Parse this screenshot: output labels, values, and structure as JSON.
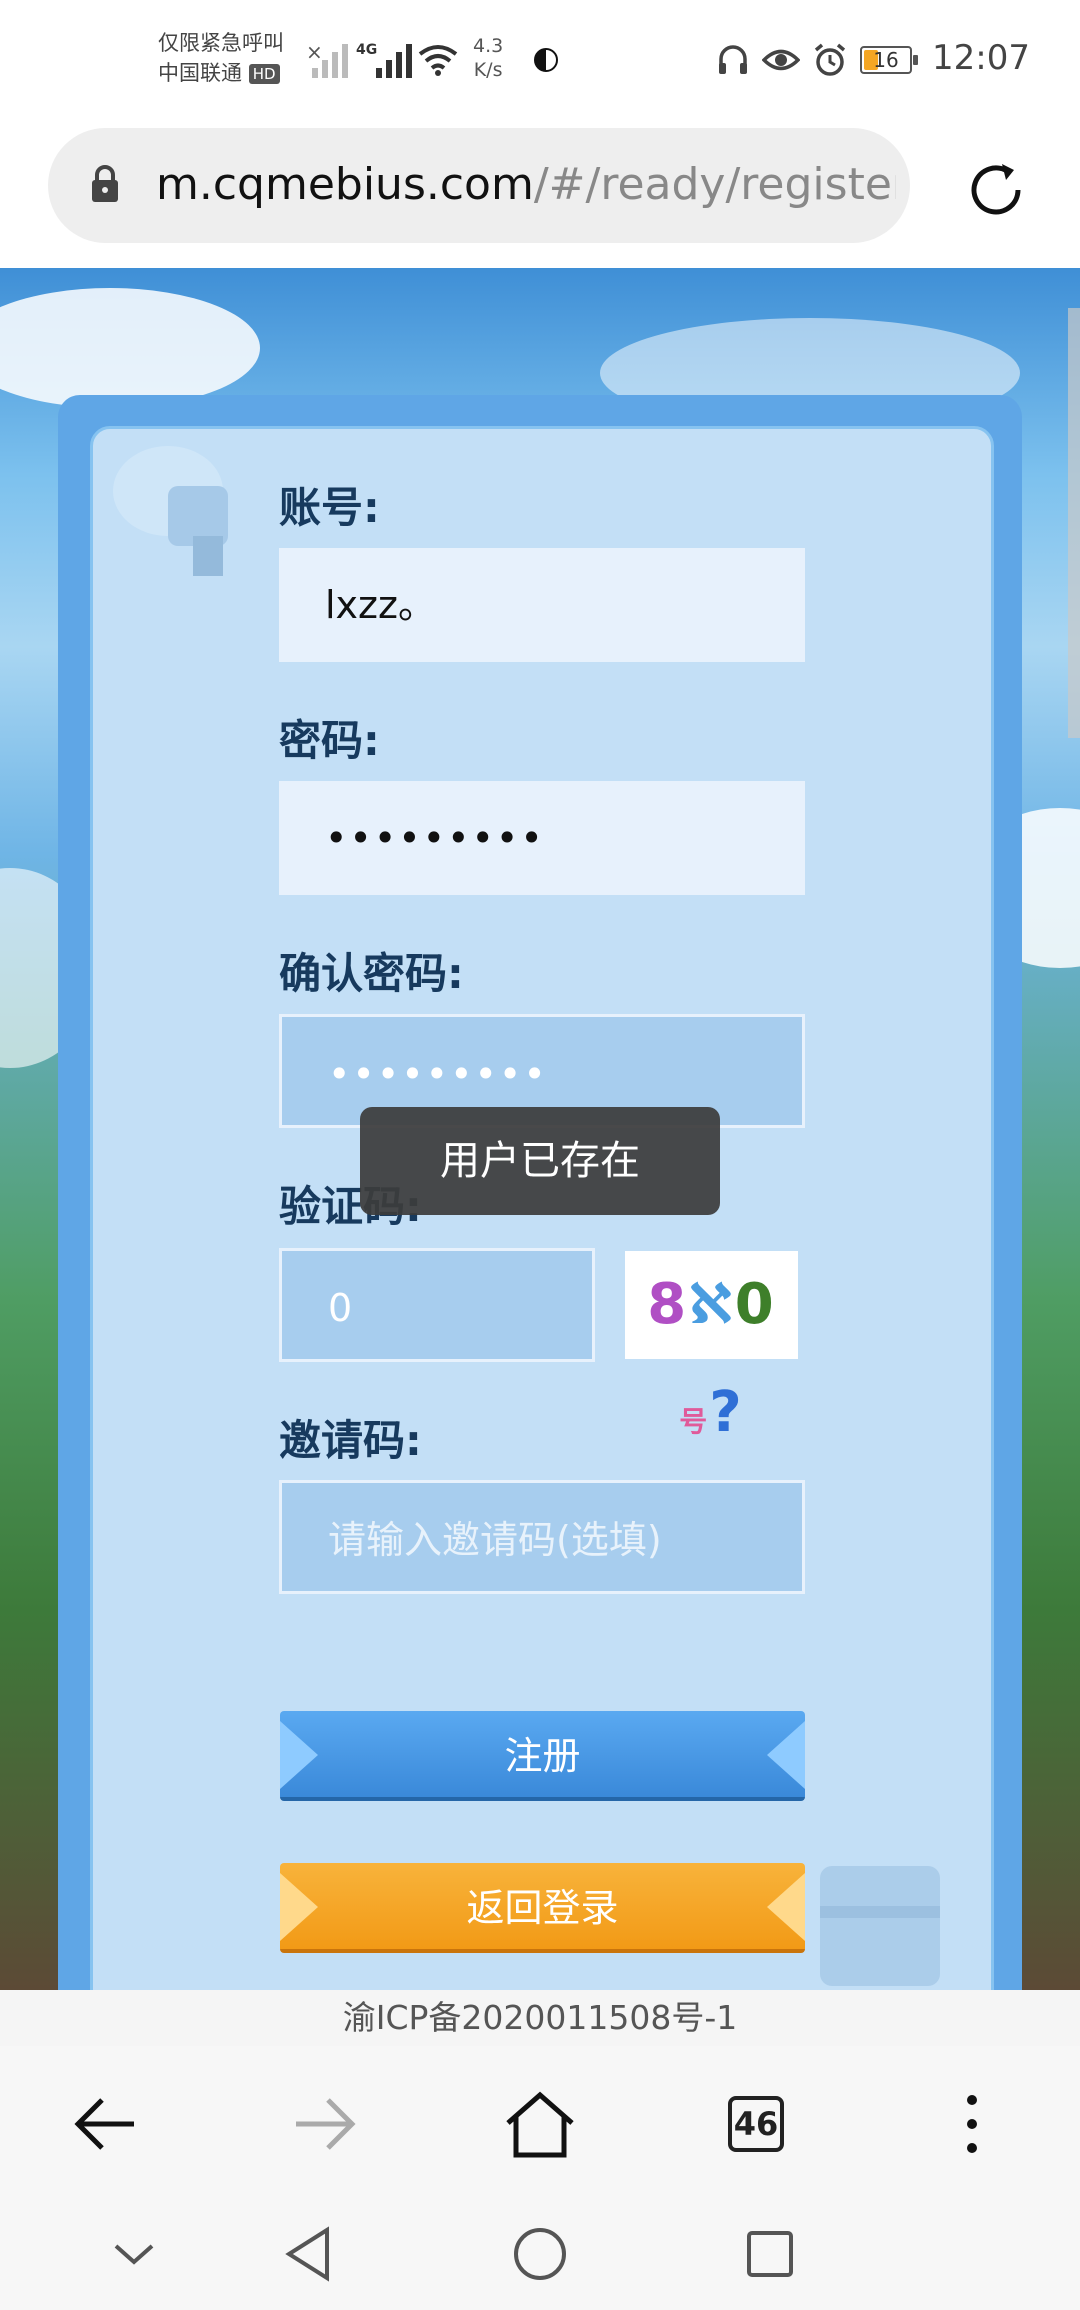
{
  "status_bar": {
    "carrier_line1": "仅限紧急呼叫",
    "carrier_line2": "中国联通",
    "hd_badge": "HD",
    "network_type": "4G",
    "speed_value": "4.3",
    "speed_unit": "K/s",
    "battery_level": "16",
    "time": "12:07"
  },
  "address_bar": {
    "host": "m.cqmebius.com",
    "path": "/#/ready/register"
  },
  "form": {
    "account_label": "账号:",
    "account_value": "lxzz。",
    "password_label": "密码:",
    "password_value": "•••••••••",
    "confirm_label": "确认密码:",
    "confirm_value": "•••••••••",
    "captcha_label": "验证码:",
    "captcha_value": "0",
    "captcha_image_text": [
      "8",
      "ℵ",
      "0",
      "号",
      "?"
    ],
    "invite_label": "邀请码:",
    "invite_placeholder": "请输入邀请码(选填)",
    "register_button": "注册",
    "back_login_button": "返回登录"
  },
  "toast": {
    "message": "用户已存在"
  },
  "footer": {
    "icp": "渝ICP备2020011508号-1"
  },
  "browser_nav": {
    "tab_count": "46"
  },
  "colors": {
    "panel_bg": "#c3dff6",
    "label_color": "#173a5e",
    "register_blue": "#3a89d9",
    "back_orange": "#f29a16"
  }
}
